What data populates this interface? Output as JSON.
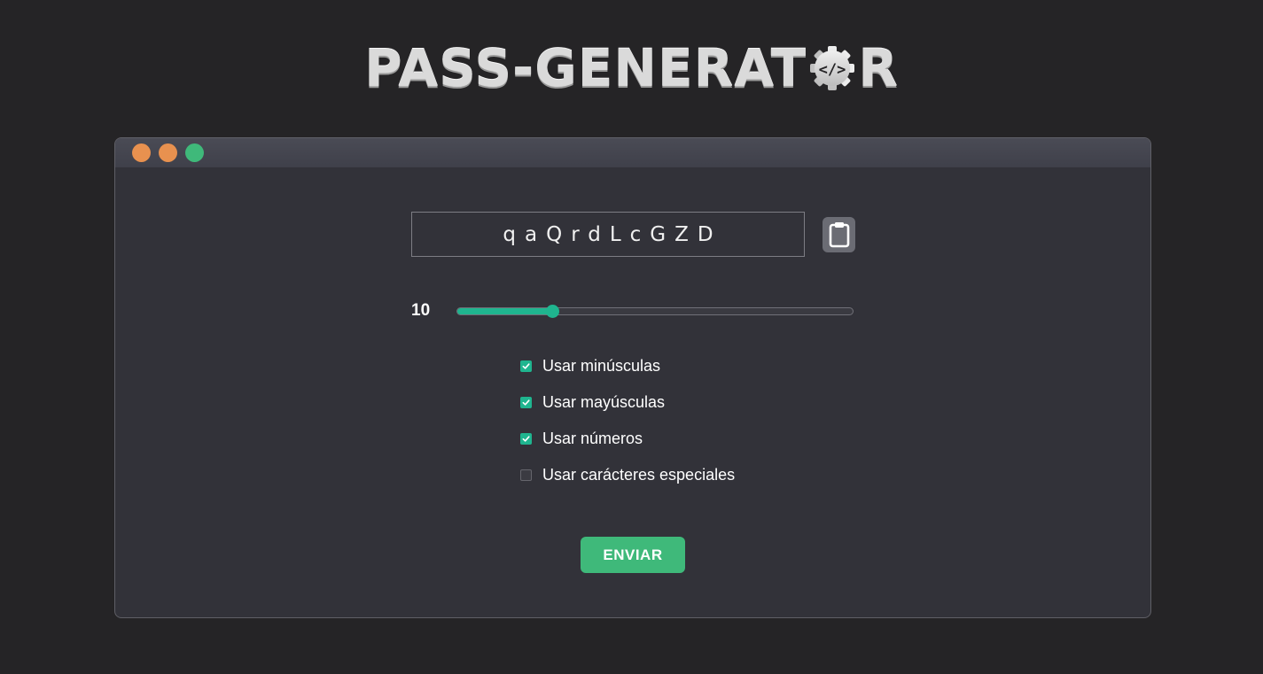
{
  "logo": {
    "text_before": "PASS-GENERAT",
    "gear_icon": "gear-code-icon",
    "text_after": "R"
  },
  "window": {
    "dots": [
      {
        "name": "dot-close",
        "color": "#e8914f"
      },
      {
        "name": "dot-minimize",
        "color": "#e8914f"
      },
      {
        "name": "dot-maximize",
        "color": "#3fb97a"
      }
    ]
  },
  "password": {
    "value": "qaQrdLcGZD",
    "copy_icon": "clipboard-icon"
  },
  "length": {
    "value": "10",
    "slider_fraction": 0.24
  },
  "options": [
    {
      "label": "Usar minúsculas",
      "checked": true
    },
    {
      "label": "Usar mayúsculas",
      "checked": true
    },
    {
      "label": "Usar números",
      "checked": true
    },
    {
      "label": "Usar carácteres especiales",
      "checked": false
    }
  ],
  "submit": {
    "label": "ENVIAR"
  },
  "colors": {
    "background": "#252426",
    "panel": "#323239",
    "accent": "#1fb58f",
    "button": "#3fb97a"
  }
}
